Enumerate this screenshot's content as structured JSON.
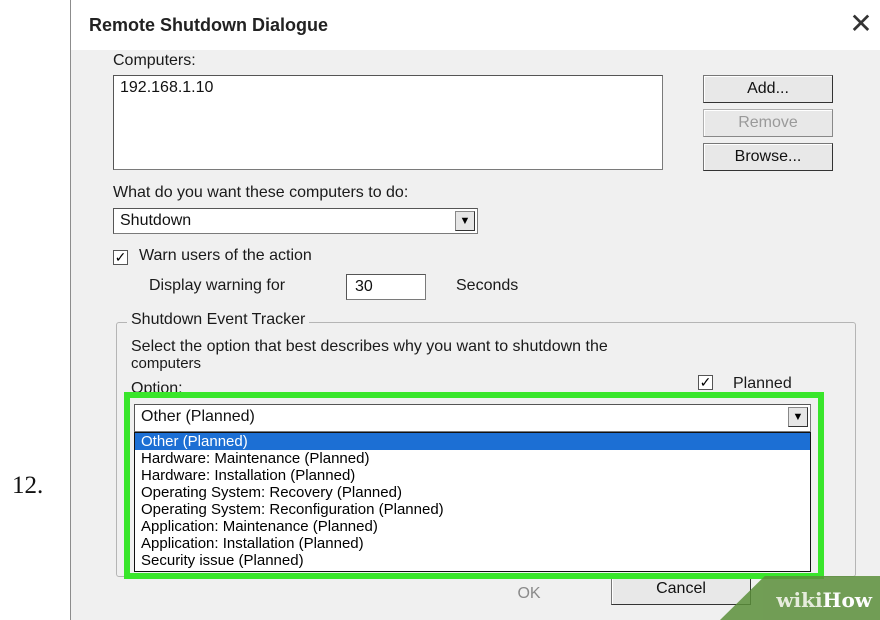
{
  "step_number": "12.",
  "dialog": {
    "title": "Remote Shutdown Dialogue",
    "close_glyph": "✕"
  },
  "computers": {
    "label": "Computers:",
    "items": [
      "192.168.1.10"
    ]
  },
  "buttons": {
    "add": "Add...",
    "remove": "Remove",
    "browse": "Browse..."
  },
  "action": {
    "question": "What do you want these computers to do:",
    "selected": "Shutdown"
  },
  "warn": {
    "checked": true,
    "label": "Warn users of the action",
    "display_label": "Display warning for",
    "seconds_value": "30",
    "seconds_unit": "Seconds"
  },
  "tracker": {
    "title": "Shutdown Event Tracker",
    "description_line1": "Select the option that best describes why you want to shutdown the",
    "description_line2": "computers",
    "option_label": "Option:",
    "planned_label": "Planned",
    "planned_checked": true,
    "selected": "Other (Planned)",
    "options": [
      "Other (Planned)",
      "Hardware: Maintenance (Planned)",
      "Hardware: Installation (Planned)",
      "Operating System: Recovery (Planned)",
      "Operating System: Reconfiguration (Planned)",
      "Application: Maintenance (Planned)",
      "Application: Installation (Planned)",
      "Security issue (Planned)"
    ]
  },
  "footer": {
    "ok": "OK",
    "cancel": "Cancel"
  },
  "watermark": {
    "wiki": "wiki",
    "how": "How"
  },
  "colors": {
    "highlight": "#39e62b",
    "selection": "#1c6fd4"
  }
}
